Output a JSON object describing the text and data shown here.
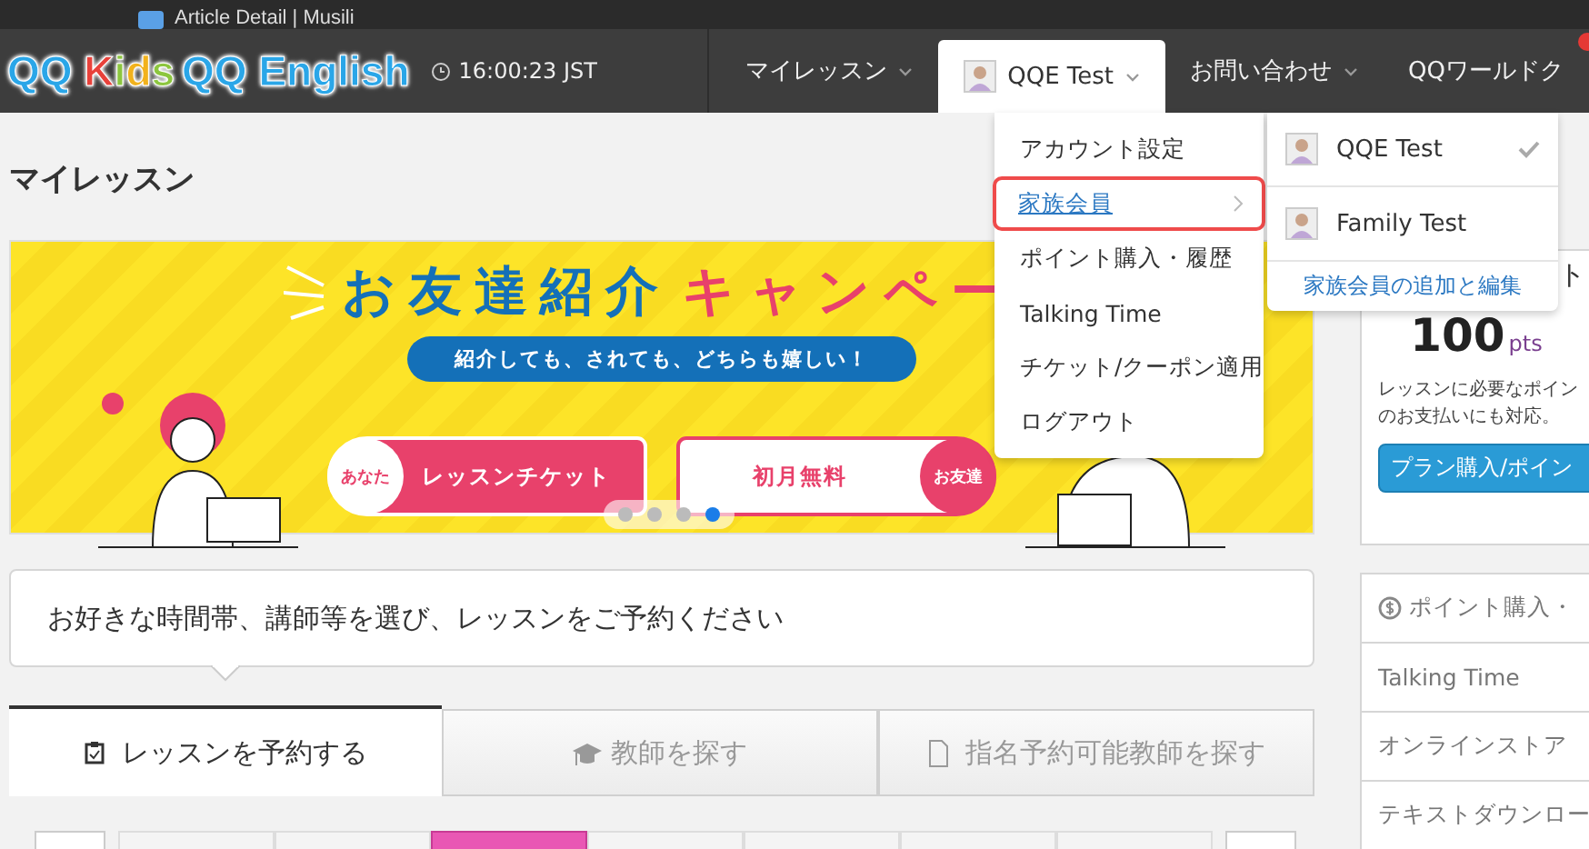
{
  "bookmarks": [
    {
      "label": "Article Detail | Musili"
    }
  ],
  "header": {
    "logo_kids": "QQ Kids",
    "logo_english": "QQ English",
    "time": "16:00:23 JST",
    "nav": [
      {
        "label": "マイレッスン",
        "kind": "menu",
        "selected": false
      },
      {
        "label": "QQE Test",
        "kind": "user",
        "selected": true
      },
      {
        "label": "お問い合わせ",
        "kind": "menu",
        "selected": false
      },
      {
        "label": "QQワールドク",
        "kind": "badge",
        "selected": false
      }
    ]
  },
  "page_title": "マイレッスン",
  "banner": {
    "title_blue": "お友達紹介",
    "title_pink": "キャンペー",
    "tagline": "紹介しても、されても、どちらも嬉しい！",
    "left_badge": "あなた",
    "left_label": "レッスンチケット",
    "right_label": "初月無料",
    "right_badge": "お友達",
    "slides": [
      {
        "selected": false
      },
      {
        "selected": false
      },
      {
        "selected": false
      },
      {
        "selected": true
      }
    ]
  },
  "instruction": "お好きな時間帯、講師等を選び、レッスンをご予約ください",
  "tabs": [
    {
      "label": "レッスンを予約する",
      "kind": "booking",
      "selected": true
    },
    {
      "label": "教師を探す",
      "kind": "teachers",
      "selected": false
    },
    {
      "label": "指名予約可能教師を探す",
      "kind": "designated",
      "selected": false
    }
  ],
  "date_cells": [
    {
      "selected": false
    },
    {
      "selected": false
    },
    {
      "selected": true
    },
    {
      "selected": false
    },
    {
      "selected": false
    },
    {
      "selected": false
    },
    {
      "selected": false
    }
  ],
  "points_card": {
    "heading": "ト",
    "points": "100",
    "unit": "pts",
    "description": [
      "レッスンに必要なポイン",
      "のお支払いにも対応。"
    ],
    "button": "プラン購入/ポイン"
  },
  "side_links": [
    {
      "label": "ポイント購入・",
      "kind": "points"
    },
    {
      "label": "Talking Time",
      "kind": "link"
    },
    {
      "label": "オンラインストア",
      "kind": "link"
    },
    {
      "label": "テキストダウンロー",
      "kind": "link"
    }
  ],
  "account_menu": [
    {
      "label": "アカウント設定",
      "selected": false,
      "has_submenu": false
    },
    {
      "label": "家族会員",
      "selected": true,
      "has_submenu": true
    },
    {
      "label": "ポイント購入・履歴",
      "selected": false,
      "has_submenu": false
    },
    {
      "label": "Talking Time",
      "selected": false,
      "has_submenu": false
    },
    {
      "label": "チケット/クーポン適用",
      "selected": false,
      "has_submenu": false
    },
    {
      "label": "ログアウト",
      "selected": false,
      "has_submenu": false
    }
  ],
  "family_menu": {
    "members": [
      {
        "name": "QQE Test",
        "checked": true
      },
      {
        "name": "Family Test",
        "checked": false
      }
    ],
    "manage_link": "家族会員の追加と編集"
  }
}
